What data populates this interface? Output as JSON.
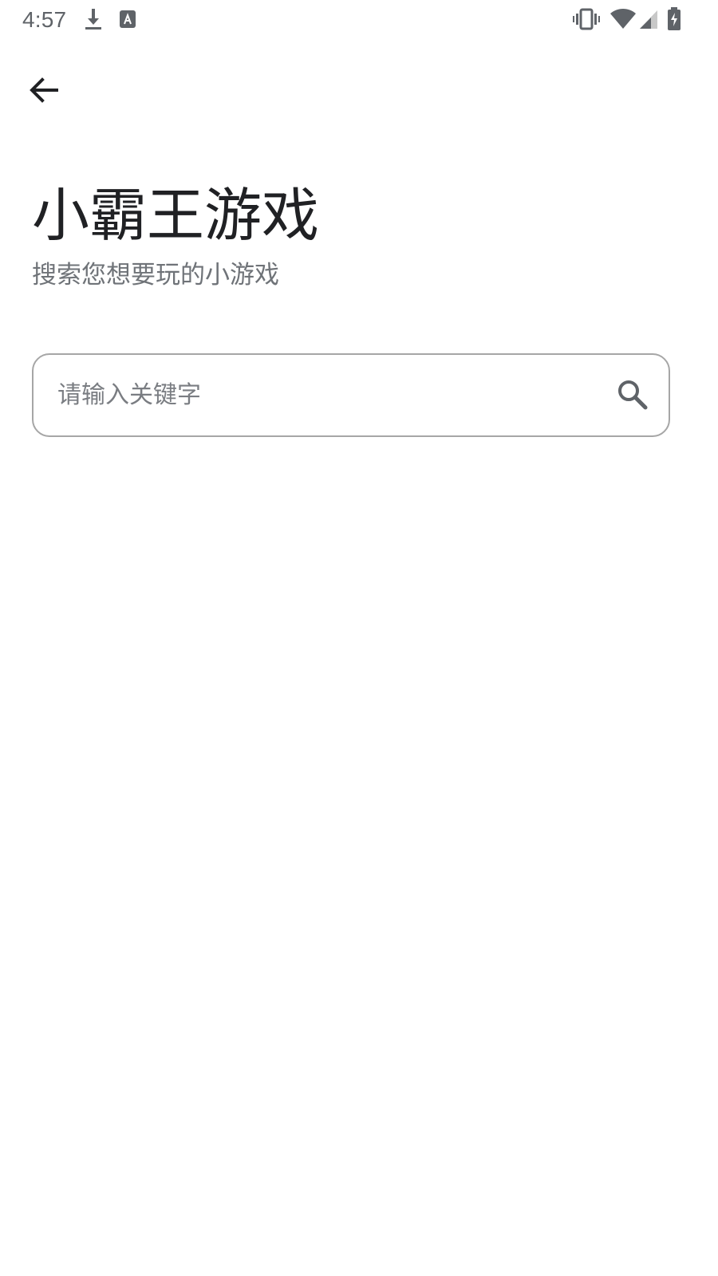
{
  "status_bar": {
    "time": "4:57",
    "left_icons": [
      "download-icon",
      "a-badge-icon"
    ],
    "right_icons": [
      "vibrate-icon",
      "wifi-icon",
      "signal-icon",
      "battery-charging-icon"
    ]
  },
  "header": {
    "back_icon": "back-arrow-icon"
  },
  "main": {
    "title": "小霸王游戏",
    "subtitle": "搜索您想要玩的小游戏"
  },
  "search": {
    "value": "",
    "placeholder": "请输入关键字",
    "icon": "search-icon"
  },
  "colors": {
    "background": "#ffffff",
    "title": "#202124",
    "subtitle": "#6f7378",
    "border": "#a6a6a6",
    "icon": "#5f6368"
  }
}
